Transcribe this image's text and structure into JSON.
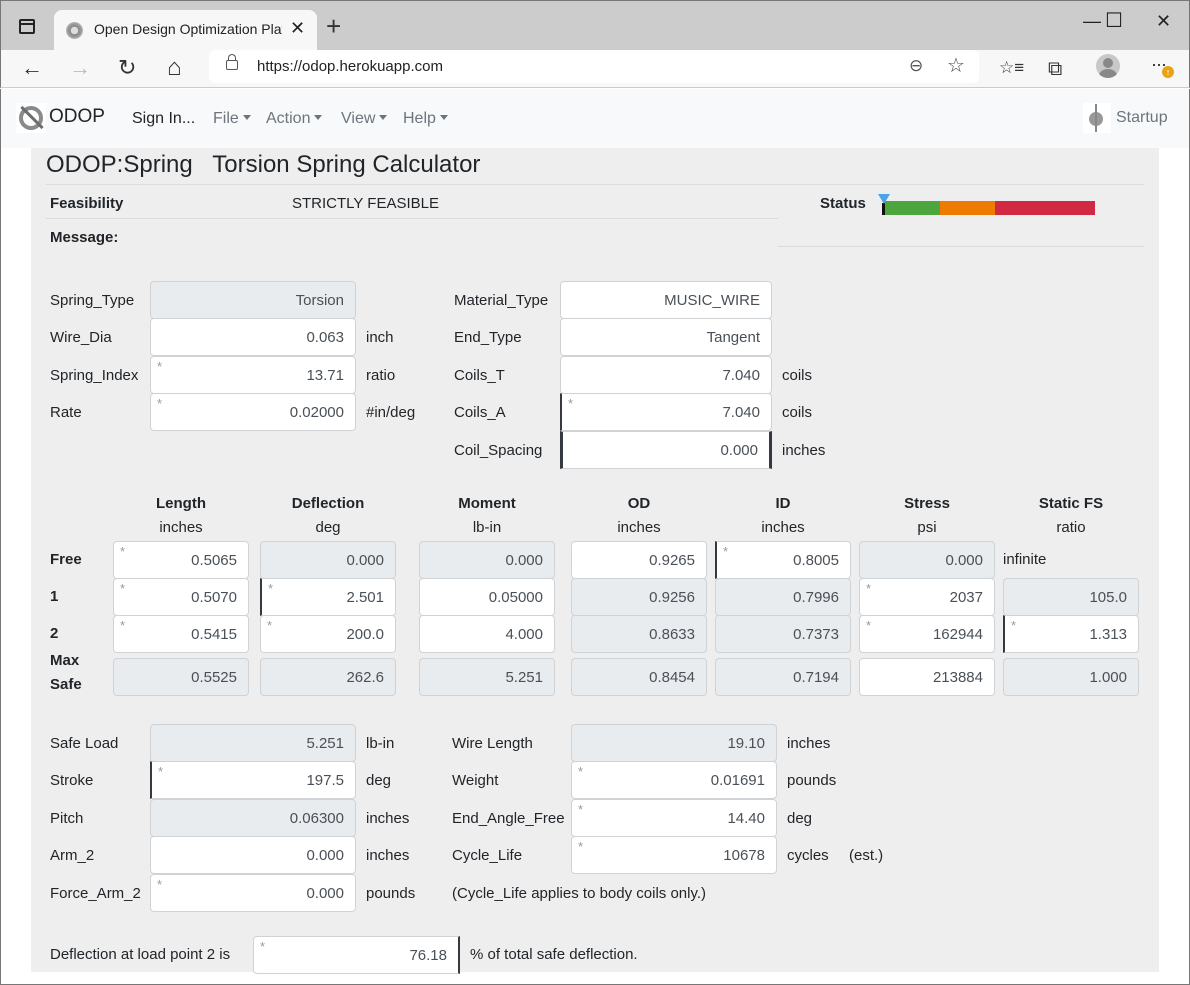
{
  "browser": {
    "tab_title": "Open Design Optimization Platform",
    "tab_close": "✕",
    "new_tab": "+",
    "url": "https://odop.herokuapp.com",
    "window_controls": {
      "minimize": "—",
      "maximize": "☐",
      "close": "✕"
    },
    "icons": {
      "back": "←",
      "forward": "→",
      "reload": "↻",
      "home": "⌂",
      "zoom": "⊖",
      "favorite_add": "☆",
      "favorites": "☆≡",
      "collections": "⧉",
      "menu": "···",
      "update": "↑"
    }
  },
  "navbar": {
    "brand": "ODOP",
    "items": [
      {
        "label": "Sign In...",
        "dropdown": false
      },
      {
        "label": "File",
        "dropdown": true
      },
      {
        "label": "Action",
        "dropdown": true
      },
      {
        "label": "View",
        "dropdown": true
      },
      {
        "label": "Help",
        "dropdown": true
      }
    ],
    "startup_label": "Startup"
  },
  "page": {
    "title": "ODOP:Spring   Torsion Spring Calculator",
    "feasibility_label": "Feasibility",
    "feasibility_value": "STRICTLY FEASIBLE",
    "message_label": "Message:",
    "status_label": "Status",
    "status_bar": {
      "segments": [
        {
          "name": "feasible",
          "color": "#4ca63d",
          "fraction": 0.27
        },
        {
          "name": "marginal",
          "color": "#ee7a00",
          "fraction": 0.26
        },
        {
          "name": "infeasible",
          "color": "#d02941",
          "fraction": 0.47
        }
      ],
      "marker_position": 0.0,
      "marker_color": "#4da3e8"
    }
  },
  "params_left": [
    {
      "label": "Spring_Type",
      "value": "Torsion",
      "unit": "",
      "readonly": true,
      "star": false
    },
    {
      "label": "Wire_Dia",
      "value": "0.063",
      "unit": "inch",
      "readonly": false,
      "star": false
    },
    {
      "label": "Spring_Index",
      "value": "13.71",
      "unit": "ratio",
      "readonly": false,
      "star": true
    },
    {
      "label": "Rate",
      "value": "0.02000",
      "unit": "#in/deg",
      "readonly": false,
      "star": true
    }
  ],
  "params_right": [
    {
      "label": "Material_Type",
      "value": "MUSIC_WIRE",
      "unit": "",
      "star": false
    },
    {
      "label": "End_Type",
      "value": "Tangent",
      "unit": "",
      "star": false
    },
    {
      "label": "Coils_T",
      "value": "7.040",
      "unit": "coils",
      "star": false
    },
    {
      "label": "Coils_A",
      "value": "7.040",
      "unit": "coils",
      "star": true
    },
    {
      "label": "Coil_Spacing",
      "value": "0.000",
      "unit": "inches",
      "star": false
    }
  ],
  "table": {
    "columns": [
      {
        "name": "Length",
        "unit": "inches"
      },
      {
        "name": "Deflection",
        "unit": "deg"
      },
      {
        "name": "Moment",
        "unit": "lb-in"
      },
      {
        "name": "OD",
        "unit": "inches"
      },
      {
        "name": "ID",
        "unit": "inches"
      },
      {
        "name": "Stress",
        "unit": "psi"
      },
      {
        "name": "Static FS",
        "unit": "ratio"
      }
    ],
    "rows": [
      {
        "label": "Free",
        "cells": [
          {
            "value": "0.5065",
            "ro": false,
            "star": true
          },
          {
            "value": "0.000",
            "ro": true,
            "star": false
          },
          {
            "value": "0.000",
            "ro": true,
            "star": false
          },
          {
            "value": "0.9265",
            "ro": false,
            "star": false
          },
          {
            "value": "0.8005",
            "ro": false,
            "star": true
          },
          {
            "value": "0.000",
            "ro": true,
            "star": false
          },
          {
            "value": "infinite",
            "text": true
          }
        ]
      },
      {
        "label": "1",
        "cells": [
          {
            "value": "0.5070",
            "ro": false,
            "star": true
          },
          {
            "value": "2.501",
            "ro": false,
            "star": true
          },
          {
            "value": "0.05000",
            "ro": false,
            "star": false
          },
          {
            "value": "0.9256",
            "ro": true,
            "star": false
          },
          {
            "value": "0.7996",
            "ro": true,
            "star": false
          },
          {
            "value": "2037",
            "ro": false,
            "star": true
          },
          {
            "value": "105.0",
            "ro": true,
            "star": false
          }
        ]
      },
      {
        "label": "2",
        "cells": [
          {
            "value": "0.5415",
            "ro": false,
            "star": true
          },
          {
            "value": "200.0",
            "ro": false,
            "star": true
          },
          {
            "value": "4.000",
            "ro": false,
            "star": false
          },
          {
            "value": "0.8633",
            "ro": true,
            "star": false
          },
          {
            "value": "0.7373",
            "ro": true,
            "star": false
          },
          {
            "value": "162944",
            "ro": false,
            "star": true
          },
          {
            "value": "1.313",
            "ro": false,
            "star": true
          }
        ]
      },
      {
        "label": "Max Safe",
        "label_line1": "Max",
        "label_line2": "Safe",
        "cells": [
          {
            "value": "0.5525",
            "ro": true,
            "star": false
          },
          {
            "value": "262.6",
            "ro": true,
            "star": false
          },
          {
            "value": "5.251",
            "ro": true,
            "star": false
          },
          {
            "value": "0.8454",
            "ro": true,
            "star": false
          },
          {
            "value": "0.7194",
            "ro": true,
            "star": false
          },
          {
            "value": "213884",
            "ro": false,
            "star": false
          },
          {
            "value": "1.000",
            "ro": true,
            "star": false
          }
        ]
      }
    ]
  },
  "report_left": [
    {
      "label": "Safe Load",
      "value": "5.251",
      "unit": "lb-in",
      "readonly": true,
      "star": false
    },
    {
      "label": "Stroke",
      "value": "197.5",
      "unit": "deg",
      "readonly": false,
      "star": true
    },
    {
      "label": "Pitch",
      "value": "0.06300",
      "unit": "inches",
      "readonly": true,
      "star": false
    },
    {
      "label": "Arm_2",
      "value": "0.000",
      "unit": "inches",
      "readonly": false,
      "star": false
    },
    {
      "label": "Force_Arm_2",
      "value": "0.000",
      "unit": "pounds",
      "readonly": false,
      "star": true
    }
  ],
  "report_right": [
    {
      "label": "Wire Length",
      "value": "19.10",
      "unit": "inches",
      "readonly": true,
      "star": false
    },
    {
      "label": "Weight",
      "value": "0.01691",
      "unit": "pounds",
      "readonly": false,
      "star": true
    },
    {
      "label": "End_Angle_Free",
      "value": "14.40",
      "unit": "deg",
      "readonly": false,
      "star": true
    },
    {
      "label": "Cycle_Life",
      "value": "10678",
      "unit": "cycles",
      "extra": "(est.)",
      "readonly": false,
      "star": true
    }
  ],
  "cycle_life_note": "(Cycle_Life applies to body coils only.)",
  "deflection_note": {
    "prefix": "Deflection at load point 2 is",
    "value": "76.18",
    "suffix": "% of total safe deflection.",
    "star": true
  },
  "star_glyph": "*"
}
